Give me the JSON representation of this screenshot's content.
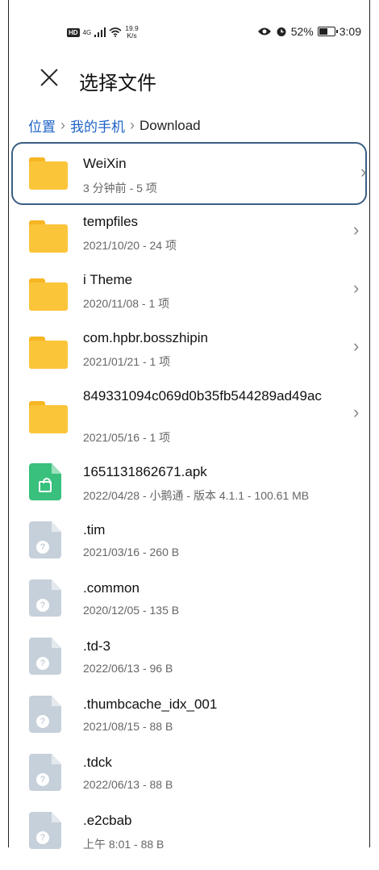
{
  "status_bar": {
    "hd": "HD",
    "network": "4G",
    "speed_value": "19.9",
    "speed_unit": "K/s",
    "battery": "52%",
    "time": "3:09"
  },
  "header": {
    "title": "选择文件"
  },
  "breadcrumb": [
    {
      "label": "位置"
    },
    {
      "label": "我的手机"
    },
    {
      "label": "Download"
    }
  ],
  "files": [
    {
      "name": "WeiXin",
      "meta": "3 分钟前 - 5 项",
      "type": "folder",
      "selected": true
    },
    {
      "name": "tempfiles",
      "meta": "2021/10/20 - 24 项",
      "type": "folder"
    },
    {
      "name": "i Theme",
      "meta": "2020/11/08 - 1 项",
      "type": "folder"
    },
    {
      "name": "com.hpbr.bosszhipin",
      "meta": "2021/01/21 - 1 项",
      "type": "folder"
    },
    {
      "name": "849331094c069d0b35fb544289ad49ac",
      "meta": "2021/05/16 - 1 项",
      "type": "folder"
    },
    {
      "name": "1651131862671.apk",
      "meta": "2022/04/28 - 小鹅通 - 版本 4.1.1 - 100.61 MB",
      "type": "apk"
    },
    {
      "name": ".tim",
      "meta": "2021/03/16 - 260 B",
      "type": "unknown"
    },
    {
      "name": ".common",
      "meta": "2020/12/05 - 135 B",
      "type": "unknown"
    },
    {
      "name": ".td-3",
      "meta": "2022/06/13 - 96 B",
      "type": "unknown"
    },
    {
      "name": ".thumbcache_idx_001",
      "meta": "2021/08/15 - 88 B",
      "type": "unknown"
    },
    {
      "name": ".tdck",
      "meta": "2022/06/13 - 88 B",
      "type": "unknown"
    },
    {
      "name": ".e2cbab",
      "meta": "上午 8:01 - 88 B",
      "type": "unknown"
    }
  ]
}
